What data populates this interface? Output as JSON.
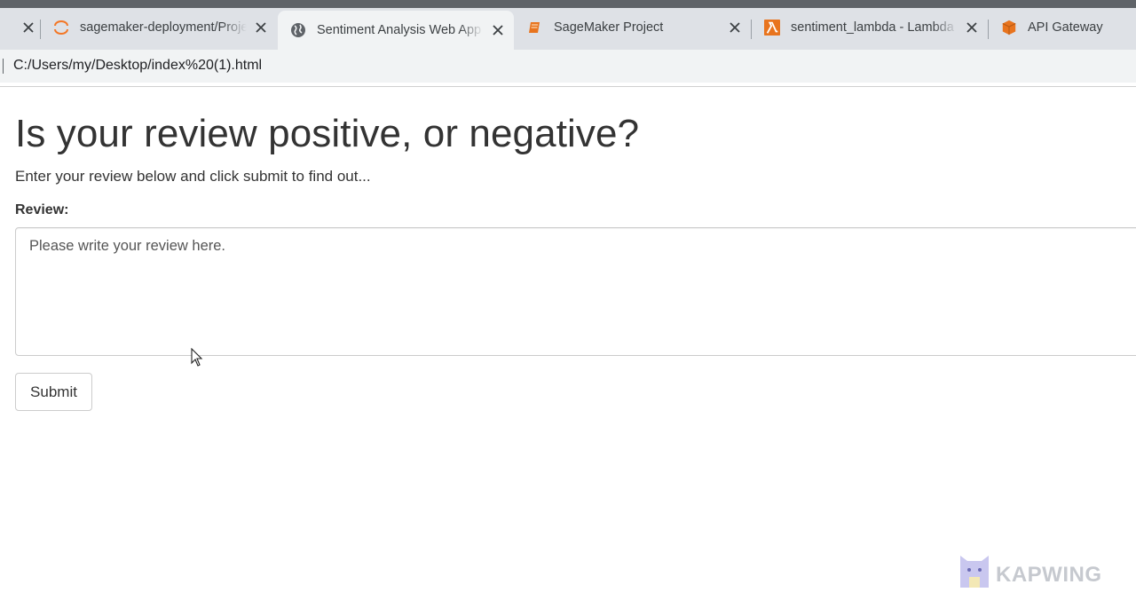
{
  "browser": {
    "tabs": [
      {
        "title": "",
        "icon": "close-icon",
        "active": false
      },
      {
        "title": "sagemaker-deployment/Project",
        "icon": "jupyter-icon",
        "active": false
      },
      {
        "title": "Sentiment Analysis Web App",
        "icon": "globe-icon",
        "active": true
      },
      {
        "title": "SageMaker Project",
        "icon": "notebook-icon",
        "active": false
      },
      {
        "title": "sentiment_lambda - Lambda",
        "icon": "lambda-icon",
        "active": false
      },
      {
        "title": "API Gateway",
        "icon": "api-gateway-icon",
        "active": false
      }
    ],
    "address": "C:/Users/my/Desktop/index%20(1).html"
  },
  "page": {
    "heading": "Is your review positive, or negative?",
    "intro": "Enter your review below and click submit to find out...",
    "review_label": "Review:",
    "review_placeholder": "Please write your review here.",
    "submit_label": "Submit"
  },
  "watermark": {
    "text": "KAPWING"
  },
  "colors": {
    "tabbar": "#dee1e6",
    "active_tab": "#f1f3f4",
    "lambda_orange": "#e8741e",
    "jupyter_orange": "#f37726",
    "watermark": "#c6c9cf"
  }
}
